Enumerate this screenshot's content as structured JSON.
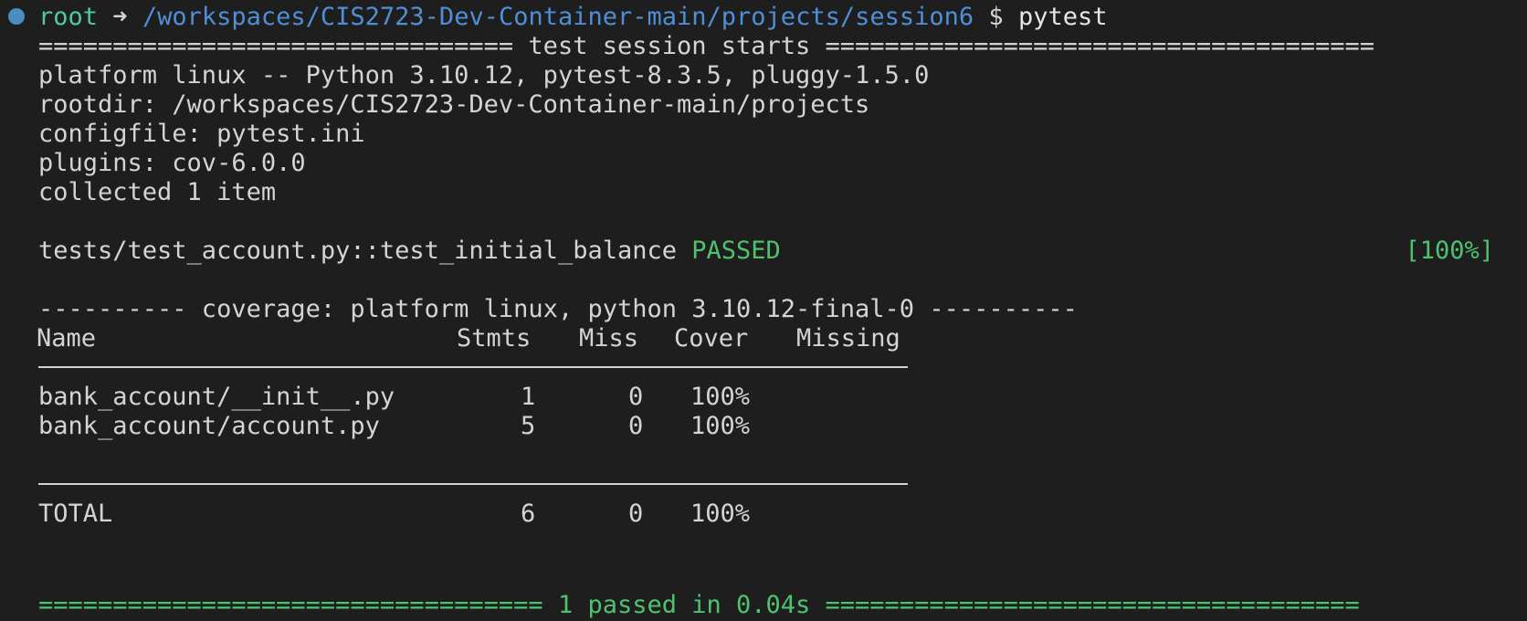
{
  "prompt": {
    "user": "root",
    "arrow": "➜",
    "path": "/workspaces/CIS2723-Dev-Container-main/projects/session6",
    "symbol": "$",
    "command": "pytest"
  },
  "session": {
    "header": "================================ test session starts =====================================",
    "platform": "platform linux -- Python 3.10.12, pytest-8.3.5, pluggy-1.5.0",
    "rootdir": "rootdir: /workspaces/CIS2723-Dev-Container-main/projects",
    "configfile": "configfile: pytest.ini",
    "plugins": "plugins: cov-6.0.0",
    "collected": "collected 1 item"
  },
  "test_result": {
    "test": "tests/test_account.py::test_initial_balance",
    "status": "PASSED",
    "progress": "[100%]"
  },
  "coverage": {
    "header": "---------- coverage: platform linux, python 3.10.12-final-0 ----------",
    "columns": {
      "name": "Name",
      "stmts": "Stmts",
      "miss": "Miss",
      "cover": "Cover",
      "missing": "Missing"
    },
    "rows": [
      {
        "name": "bank_account/__init__.py",
        "stmts": "1",
        "miss": "0",
        "cover": "100%"
      },
      {
        "name": "bank_account/account.py",
        "stmts": "5",
        "miss": "0",
        "cover": "100%"
      }
    ],
    "total": {
      "name": "TOTAL",
      "stmts": "6",
      "miss": "0",
      "cover": "100%"
    }
  },
  "footer": "================================== 1 passed in 0.04s ====================================",
  "colors": {
    "background": "#1e1e1e",
    "text": "#d4d4d4",
    "user": "#4ec9a2",
    "path": "#4f8fd8",
    "pass": "#4ec26f"
  }
}
